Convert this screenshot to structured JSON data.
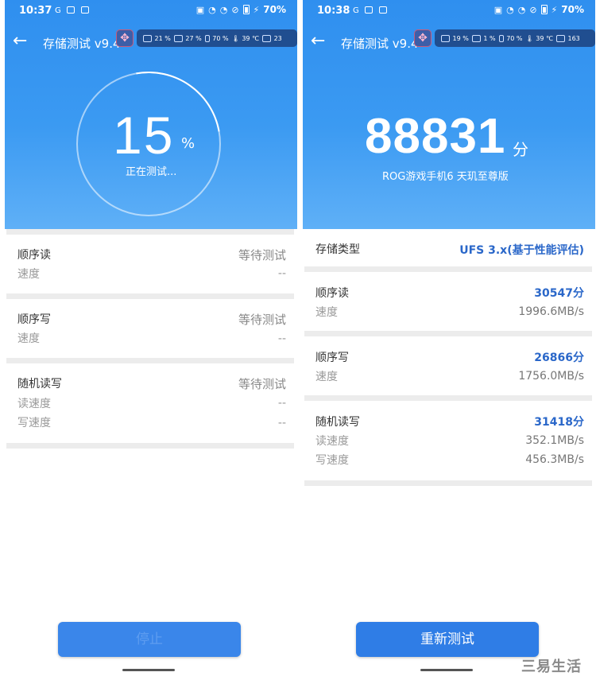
{
  "left": {
    "status": {
      "time": "10:37",
      "carrier": "G",
      "battery": "70%"
    },
    "appbar": {
      "title": "存储测试 v9.4"
    },
    "overlay": [
      {
        "label": "21 %"
      },
      {
        "label": "27 %"
      },
      {
        "label": "70 %"
      },
      {
        "label": "39 ℃"
      },
      {
        "label": "23"
      }
    ],
    "progress": {
      "value": "15",
      "unit": "%",
      "label": "正在测试...",
      "fraction": 0.15
    },
    "sections": {
      "seq_read": {
        "title": "顺序读",
        "status": "等待测试",
        "sub_label": "速度",
        "sub_value": "--"
      },
      "seq_write": {
        "title": "顺序写",
        "status": "等待测试",
        "sub_label": "速度",
        "sub_value": "--"
      },
      "random": {
        "title": "随机读写",
        "status": "等待测试",
        "read_label": "读速度",
        "read_value": "--",
        "write_label": "写速度",
        "write_value": "--"
      }
    },
    "button": {
      "label": "停止"
    }
  },
  "right": {
    "status": {
      "time": "10:38",
      "carrier": "G",
      "battery": "70%"
    },
    "appbar": {
      "title": "存储测试 v9.4"
    },
    "overlay": [
      {
        "label": "19 %"
      },
      {
        "label": "1 %"
      },
      {
        "label": "70 %"
      },
      {
        "label": "39 ℃"
      },
      {
        "label": "163"
      }
    ],
    "score": {
      "value": "88831",
      "unit": "分",
      "device": "ROG游戏手机6 天玑至尊版"
    },
    "storage": {
      "label": "存储类型",
      "value": "UFS 3.x(基于性能评估)"
    },
    "sections": {
      "seq_read": {
        "title": "顺序读",
        "score": "30547分",
        "sub_label": "速度",
        "sub_value": "1996.6MB/s"
      },
      "seq_write": {
        "title": "顺序写",
        "score": "26866分",
        "sub_label": "速度",
        "sub_value": "1756.0MB/s"
      },
      "random": {
        "title": "随机读写",
        "score": "31418分",
        "read_label": "读速度",
        "read_value": "352.1MB/s",
        "write_label": "写速度",
        "write_value": "456.3MB/s"
      }
    },
    "button": {
      "label": "重新测试"
    }
  },
  "watermark": "三易生活",
  "colors": {
    "header_blue": "#3b9af2",
    "accent_blue": "#2a67c9",
    "button_blue": "#2f7de6"
  }
}
